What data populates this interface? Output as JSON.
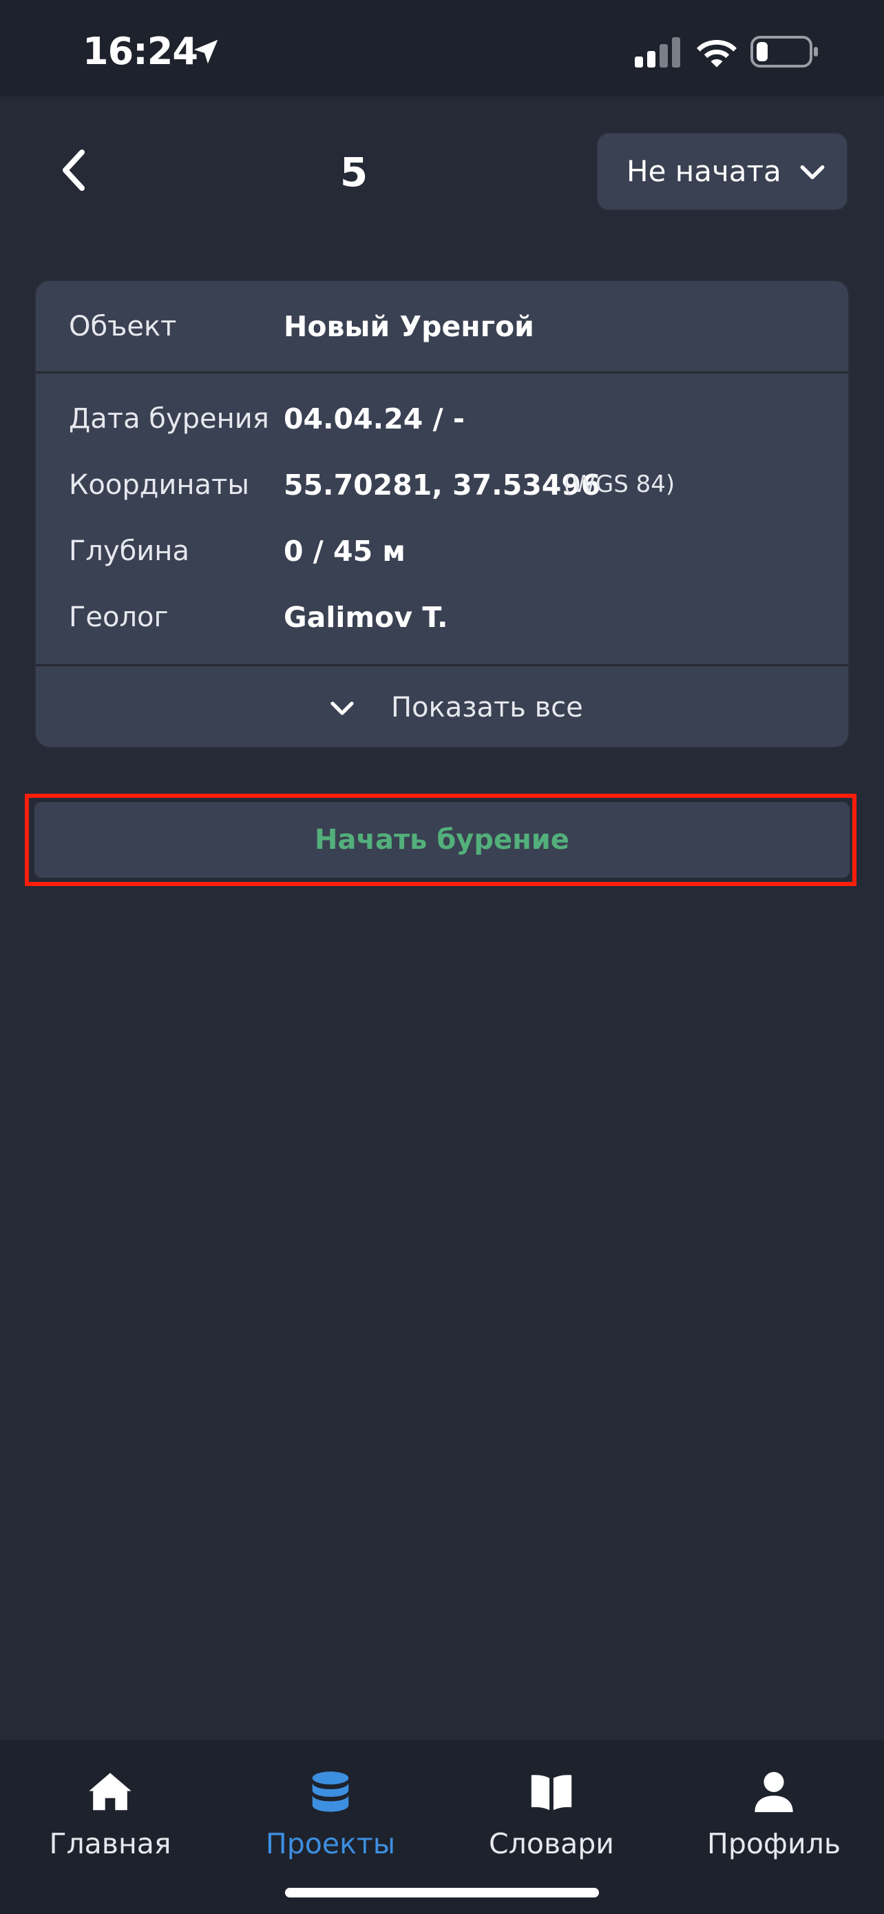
{
  "status_bar": {
    "time": "16:24",
    "icons": [
      "location-arrow-icon",
      "cellular-signal-icon",
      "wifi-icon",
      "battery-icon"
    ]
  },
  "header": {
    "title": "5",
    "back_icon": "chevron-left-icon",
    "status_select": {
      "value": "Не начата",
      "icon": "chevron-down-icon"
    }
  },
  "info_card": {
    "object": {
      "label": "Объект",
      "value": "Новый Уренгой"
    },
    "rows": [
      {
        "label": "Дата бурения",
        "value": "04.04.24 / -"
      },
      {
        "label": "Координаты",
        "value": "55.70281, 37.53496",
        "suffix": "(WGS 84)"
      },
      {
        "label": "Глубина",
        "value": "0 / 45 м"
      },
      {
        "label": "Геолог",
        "value": "Galimov T."
      }
    ],
    "show_all": "Показать все"
  },
  "actions": {
    "start_drilling": "Начать бурение"
  },
  "tab_bar": {
    "active": "projects",
    "tabs": [
      {
        "id": "home",
        "label": "Главная",
        "icon": "home-icon"
      },
      {
        "id": "projects",
        "label": "Проекты",
        "icon": "database-icon"
      },
      {
        "id": "dictionaries",
        "label": "Словари",
        "icon": "book-icon"
      },
      {
        "id": "profile",
        "label": "Профиль",
        "icon": "user-icon"
      }
    ]
  },
  "colors": {
    "background": "#252a36",
    "card": "#3a4152",
    "bars": "#1e222c",
    "accent_green": "#53b07b",
    "accent_blue": "#3d8fe0",
    "highlight_red": "#ff1e0a"
  }
}
